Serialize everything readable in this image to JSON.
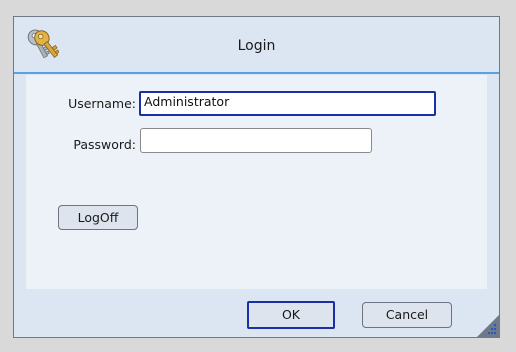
{
  "window": {
    "title": "Login",
    "icon": "keys-icon"
  },
  "form": {
    "username_label": "Username:",
    "username_value": "Administrator",
    "password_label": "Password:",
    "password_value": ""
  },
  "buttons": {
    "logoff_label": "LogOff",
    "ok_label": "OK",
    "cancel_label": "Cancel"
  },
  "colors": {
    "title_separator": "#5aa1e3",
    "focus_border": "#1a2fa3",
    "dialog_background": "#dce6f2",
    "content_background": "#edf1f8",
    "resize_grip": "#2a56b8"
  }
}
